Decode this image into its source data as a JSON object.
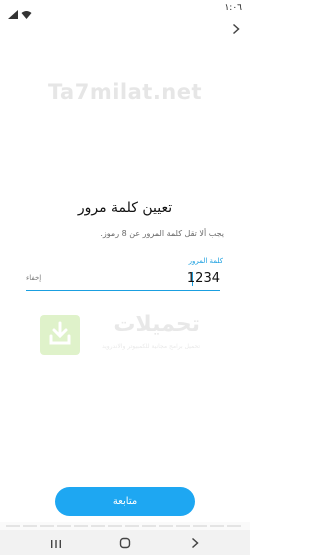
{
  "status_bar": {
    "time": "١:٠٦"
  },
  "watermark": {
    "site": "Ta7milat.net",
    "logo_text": "تحميلات",
    "logo_subtext": "تحميل برامج مجانية للكمبيوتر والاندرويد"
  },
  "form": {
    "title": "تعيين كلمة مرور",
    "subtitle": "يجب ألا تقل كلمة المرور عن 8 رموز.",
    "field_label": "كلمة المرور",
    "password_value": "1234",
    "hide_toggle": "إخفاء"
  },
  "actions": {
    "continue_label": "متابعة"
  },
  "colors": {
    "accent": "#1ea7f2",
    "field_accent": "#1a9fe0"
  },
  "icons": {
    "back": "chevron-right-icon",
    "recents": "recents-icon",
    "home": "home-icon",
    "nav_back": "chevron-right-icon"
  }
}
